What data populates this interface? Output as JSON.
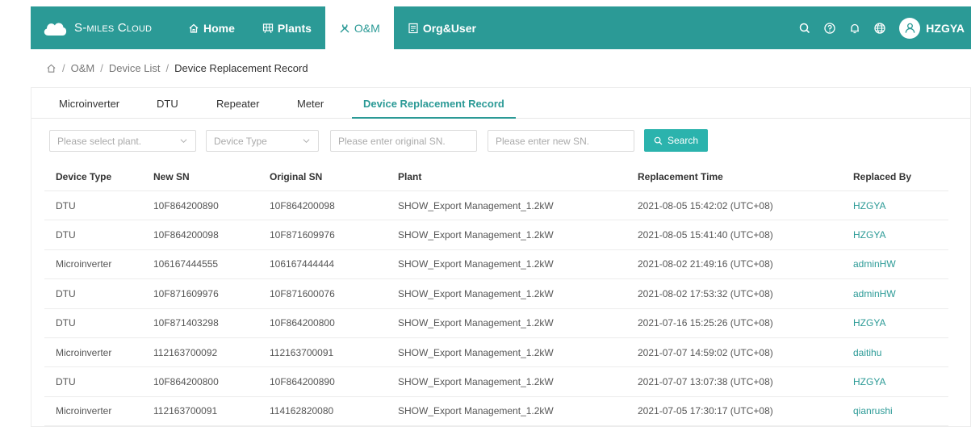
{
  "colors": {
    "primary": "#2b9a96",
    "button": "#2bb3ad"
  },
  "app": {
    "brand": "S-miles Cloud",
    "logo_icon": "cloud-icon"
  },
  "nav": [
    {
      "label": "Home",
      "icon": "home-icon"
    },
    {
      "label": "Plants",
      "icon": "plants-icon"
    },
    {
      "label": "O&M",
      "icon": "tools-icon"
    },
    {
      "label": "Org&User",
      "icon": "org-icon"
    }
  ],
  "header": {
    "username": "HZGYA"
  },
  "breadcrumb": [
    "O&M",
    "Device List",
    "Device Replacement Record"
  ],
  "tabs": [
    "Microinverter",
    "DTU",
    "Repeater",
    "Meter",
    "Device Replacement Record"
  ],
  "filters": {
    "plant_placeholder": "Please select plant.",
    "device_type_placeholder": "Device Type",
    "original_sn_placeholder": "Please enter original SN.",
    "new_sn_placeholder": "Please enter new SN.",
    "search_label": "Search"
  },
  "table": {
    "columns": [
      "Device Type",
      "New SN",
      "Original SN",
      "Plant",
      "Replacement Time",
      "Replaced By"
    ],
    "rows": [
      [
        "DTU",
        "10F864200890",
        "10F864200098",
        "SHOW_Export Management_1.2kW",
        "2021-08-05 15:42:02 (UTC+08)",
        "HZGYA"
      ],
      [
        "DTU",
        "10F864200098",
        "10F871609976",
        "SHOW_Export Management_1.2kW",
        "2021-08-05 15:41:40 (UTC+08)",
        "HZGYA"
      ],
      [
        "Microinverter",
        "106167444555",
        "106167444444",
        "SHOW_Export Management_1.2kW",
        "2021-08-02 21:49:16 (UTC+08)",
        "adminHW"
      ],
      [
        "DTU",
        "10F871609976",
        "10F871600076",
        "SHOW_Export Management_1.2kW",
        "2021-08-02 17:53:32 (UTC+08)",
        "adminHW"
      ],
      [
        "DTU",
        "10F871403298",
        "10F864200800",
        "SHOW_Export Management_1.2kW",
        "2021-07-16 15:25:26 (UTC+08)",
        "HZGYA"
      ],
      [
        "Microinverter",
        "112163700092",
        "112163700091",
        "SHOW_Export Management_1.2kW",
        "2021-07-07 14:59:02 (UTC+08)",
        "daitihu"
      ],
      [
        "DTU",
        "10F864200800",
        "10F864200890",
        "SHOW_Export Management_1.2kW",
        "2021-07-07 13:07:38 (UTC+08)",
        "HZGYA"
      ],
      [
        "Microinverter",
        "112163700091",
        "114162820080",
        "SHOW_Export Management_1.2kW",
        "2021-07-05 17:30:17 (UTC+08)",
        "qianrushi"
      ]
    ]
  }
}
